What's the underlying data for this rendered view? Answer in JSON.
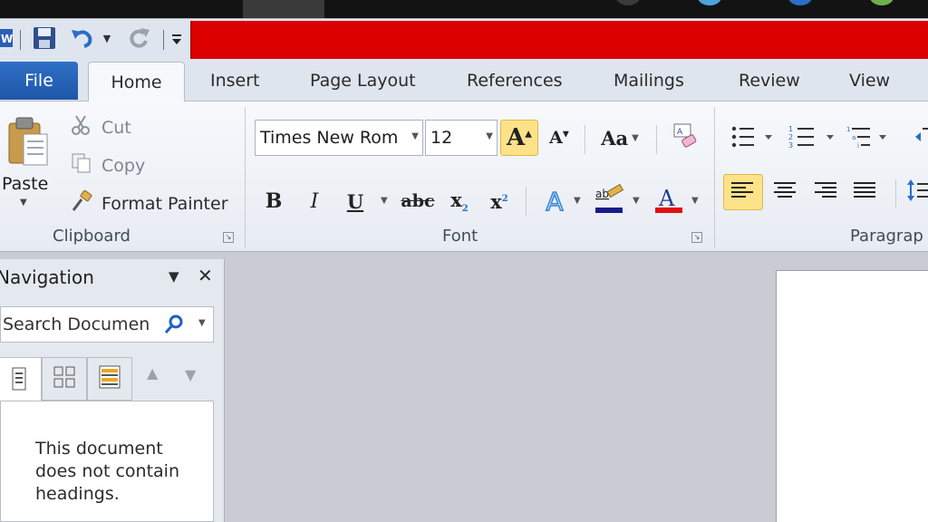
{
  "ribbon_tabs": {
    "file": "File",
    "home": "Home",
    "insert": "Insert",
    "page_layout": "Page Layout",
    "references": "References",
    "mailings": "Mailings",
    "review": "Review",
    "view": "View"
  },
  "clipboard": {
    "paste": "Paste",
    "cut": "Cut",
    "copy": "Copy",
    "format_painter": "Format Painter",
    "group_label": "Clipboard"
  },
  "font": {
    "font_name": "Times New Rom",
    "font_size": "12",
    "change_case": "Aa",
    "bold": "B",
    "italic": "I",
    "underline": "U",
    "strikethrough": "abc",
    "group_label": "Font"
  },
  "paragraph": {
    "group_label": "Paragrap"
  },
  "navigation": {
    "title": "Navigation",
    "search_placeholder": "Search Documen",
    "empty_message": "This document does not contain headings."
  },
  "colors": {
    "accent_red": "#dc0000",
    "file_tab_blue": "#2563b8",
    "highlight_yellow": "#fde28a",
    "font_color_red": "#e01010",
    "highlight_color_navy": "#1a1a8a"
  }
}
